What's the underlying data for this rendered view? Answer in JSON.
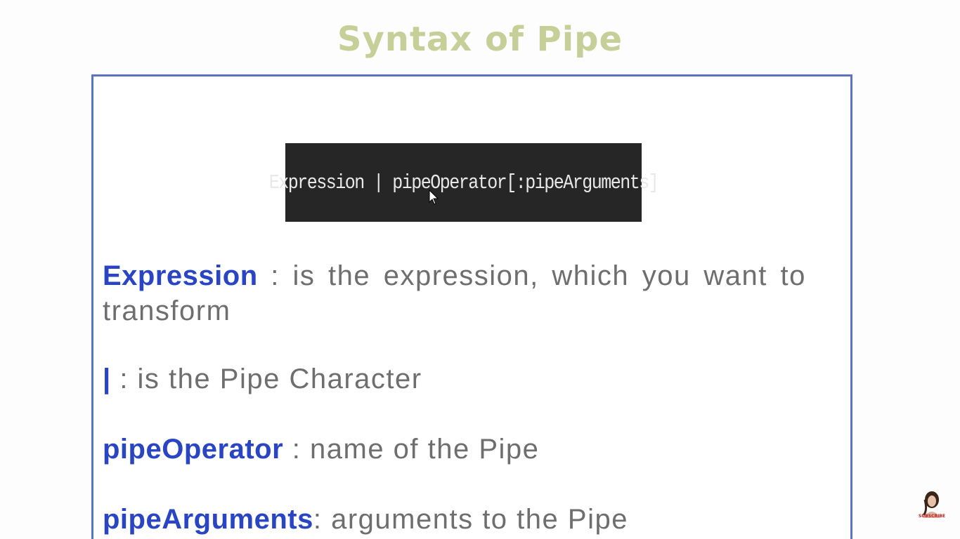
{
  "slide": {
    "title": "Syntax of Pipe",
    "code": "Expression | pipeOperator[:pipeArguments]"
  },
  "definitions": [
    {
      "term": "Expression",
      "separator": " : ",
      "text": "is the expression, which you want to transform"
    },
    {
      "term": "|",
      "separator": " : ",
      "text": "is the Pipe Character"
    },
    {
      "term": "pipeOperator",
      "separator": " : ",
      "text": "name of the Pipe"
    },
    {
      "term": "pipeArguments",
      "separator": ": ",
      "text": "arguments to the Pipe"
    }
  ],
  "overlay": {
    "subscribe_label": "SUBSCRIBE"
  },
  "colors": {
    "title": "#c6cf98",
    "term": "#2a45c4",
    "body_text": "#6e6e6e",
    "frame_border": "#5b73c4",
    "code_bg": "#262626"
  }
}
